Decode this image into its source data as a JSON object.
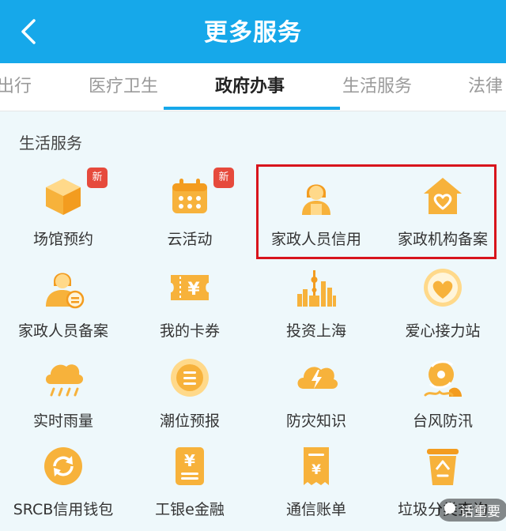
{
  "header": {
    "title": "更多服务",
    "back_icon": "chevron-left-icon"
  },
  "tabs": [
    {
      "label": "出行",
      "active": false
    },
    {
      "label": "医疗卫生",
      "active": false
    },
    {
      "label": "政府办事",
      "active": true
    },
    {
      "label": "生活服务",
      "active": false
    },
    {
      "label": "法律",
      "active": false
    }
  ],
  "section": {
    "title": "生活服务"
  },
  "services": [
    {
      "label": "场馆预约",
      "icon": "cube-box-icon",
      "badge": "新"
    },
    {
      "label": "云活动",
      "icon": "calendar-icon",
      "badge": "新"
    },
    {
      "label": "家政人员信用",
      "icon": "housekeeper-person-icon",
      "badge": ""
    },
    {
      "label": "家政机构备案",
      "icon": "house-heart-icon",
      "badge": ""
    },
    {
      "label": "家政人员备案",
      "icon": "person-stamp-icon",
      "badge": ""
    },
    {
      "label": "我的卡券",
      "icon": "yuan-ticket-icon",
      "badge": ""
    },
    {
      "label": "投资上海",
      "icon": "shanghai-skyline-icon",
      "badge": ""
    },
    {
      "label": "爱心接力站",
      "icon": "heart-circle-icon",
      "badge": ""
    },
    {
      "label": "实时雨量",
      "icon": "rain-cloud-icon",
      "badge": ""
    },
    {
      "label": "潮位预报",
      "icon": "tide-circle-icon",
      "badge": ""
    },
    {
      "label": "防灾知识",
      "icon": "lightning-cloud-icon",
      "badge": ""
    },
    {
      "label": "台风防汛",
      "icon": "typhoon-icon",
      "badge": ""
    },
    {
      "label": "SRCB信用钱包",
      "icon": "refresh-wallet-icon",
      "badge": ""
    },
    {
      "label": "工银e金融",
      "icon": "yuan-card-icon",
      "badge": ""
    },
    {
      "label": "通信账单",
      "icon": "bill-receipt-icon",
      "badge": ""
    },
    {
      "label": "垃圾分类查询",
      "icon": "recycle-bin-icon",
      "badge": ""
    }
  ],
  "watermark": {
    "text": "话重要"
  },
  "colors": {
    "header_bg": "#16a8ea",
    "icon_orange": "#f7b23b",
    "icon_light": "#ffd98a",
    "badge_red": "#e64a3c",
    "highlight_red": "#d8141c",
    "page_bg": "#eef8fb"
  }
}
